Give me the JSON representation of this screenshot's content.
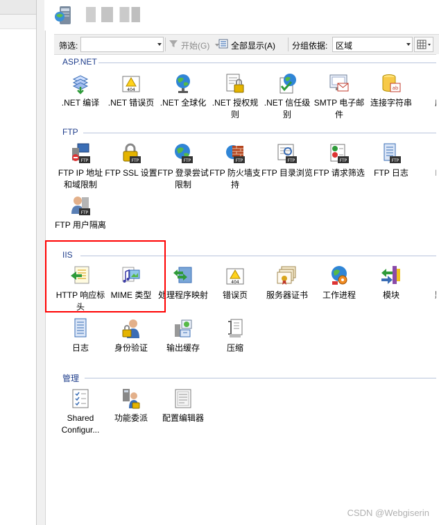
{
  "toolbar": {
    "filter_label": "筛选:",
    "start_label": "开始(G)",
    "show_all_label": "全部显示(A)",
    "group_by_label": "分组依据:",
    "group_by_value": "区域"
  },
  "sections": [
    {
      "title": "ASP.NET",
      "items": [
        {
          "label": ".NET 编译",
          "icon": "dotnet-compile-icon"
        },
        {
          "label": ".NET 错误页",
          "icon": "dotnet-error-pages-icon"
        },
        {
          "label": ".NET 全球化",
          "icon": "dotnet-globalization-icon"
        },
        {
          "label": ".NET 授权规则",
          "icon": "dotnet-authorization-icon"
        },
        {
          "label": ".NET 信任级别",
          "icon": "dotnet-trust-levels-icon"
        },
        {
          "label": "SMTP 电子邮件",
          "icon": "smtp-email-icon"
        },
        {
          "label": "连接字符串",
          "icon": "connection-strings-icon"
        },
        {
          "label": "应用",
          "icon": "application-settings-icon"
        }
      ]
    },
    {
      "title": "FTP",
      "items": [
        {
          "label": "FTP IP 地址和域限制",
          "icon": "ftp-ip-restrictions-icon"
        },
        {
          "label": "FTP SSL 设置",
          "icon": "ftp-ssl-icon"
        },
        {
          "label": "FTP 登录尝试限制",
          "icon": "ftp-logon-attempts-icon"
        },
        {
          "label": "FTP 防火墙支持",
          "icon": "ftp-firewall-icon"
        },
        {
          "label": "FTP 目录浏览",
          "icon": "ftp-directory-browsing-icon"
        },
        {
          "label": "FTP 请求筛选",
          "icon": "ftp-request-filtering-icon"
        },
        {
          "label": "FTP 日志",
          "icon": "ftp-logging-icon"
        },
        {
          "label": "FTP",
          "icon": "ftp-more-icon"
        },
        {
          "label": "FTP 用户隔离",
          "icon": "ftp-user-isolation-icon"
        }
      ]
    },
    {
      "title": "IIS",
      "items": [
        {
          "label": "HTTP 响应标头",
          "icon": "http-response-headers-icon"
        },
        {
          "label": "MIME 类型",
          "icon": "mime-types-icon"
        },
        {
          "label": "处理程序映射",
          "icon": "handler-mappings-icon"
        },
        {
          "label": "错误页",
          "icon": "error-pages-icon"
        },
        {
          "label": "服务器证书",
          "icon": "server-certificates-icon"
        },
        {
          "label": "工作进程",
          "icon": "worker-processes-icon"
        },
        {
          "label": "模块",
          "icon": "modules-icon"
        },
        {
          "label": "默认",
          "icon": "default-document-icon"
        },
        {
          "label": "日志",
          "icon": "logging-icon"
        },
        {
          "label": "身份验证",
          "icon": "authentication-icon"
        },
        {
          "label": "输出缓存",
          "icon": "output-caching-icon"
        },
        {
          "label": "压缩",
          "icon": "compression-icon"
        }
      ]
    },
    {
      "title": "管理",
      "items": [
        {
          "label": "Shared Configur...",
          "icon": "shared-configuration-icon"
        },
        {
          "label": "功能委派",
          "icon": "feature-delegation-icon"
        },
        {
          "label": "配置编辑器",
          "icon": "configuration-editor-icon"
        }
      ]
    }
  ],
  "watermark": "CSDN @Webgiserin",
  "colors": {
    "section_header": "#1f3e8c",
    "highlight_box": "#ff0000"
  }
}
